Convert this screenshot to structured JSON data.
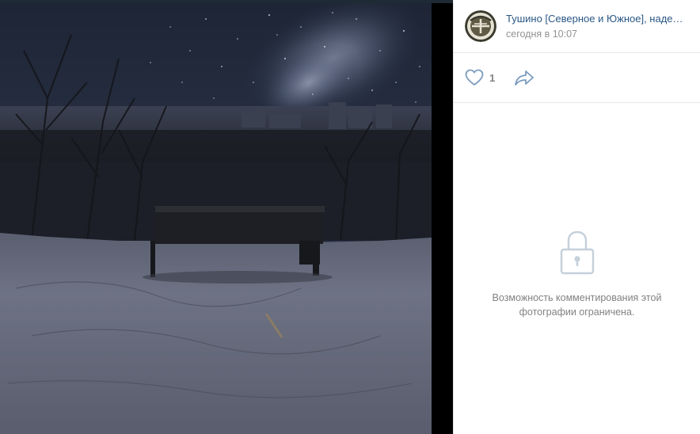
{
  "post": {
    "author_name": "Тушино [Северное и Южное], наде…",
    "time": "сегодня в 10:07",
    "avatar_icon": "tushino-emblem-avatar"
  },
  "actions": {
    "like_icon": "heart-icon",
    "like_count": "1",
    "share_icon": "share-arrow-icon"
  },
  "comments": {
    "lock_icon": "lock-icon",
    "locked_message": "Возможность комментирования этой фотографии ограничена."
  },
  "colors": {
    "link": "#2a5885",
    "muted": "#828282",
    "time": "#939393",
    "divider": "#e7e8ec",
    "icon": "#7c9cbf"
  }
}
